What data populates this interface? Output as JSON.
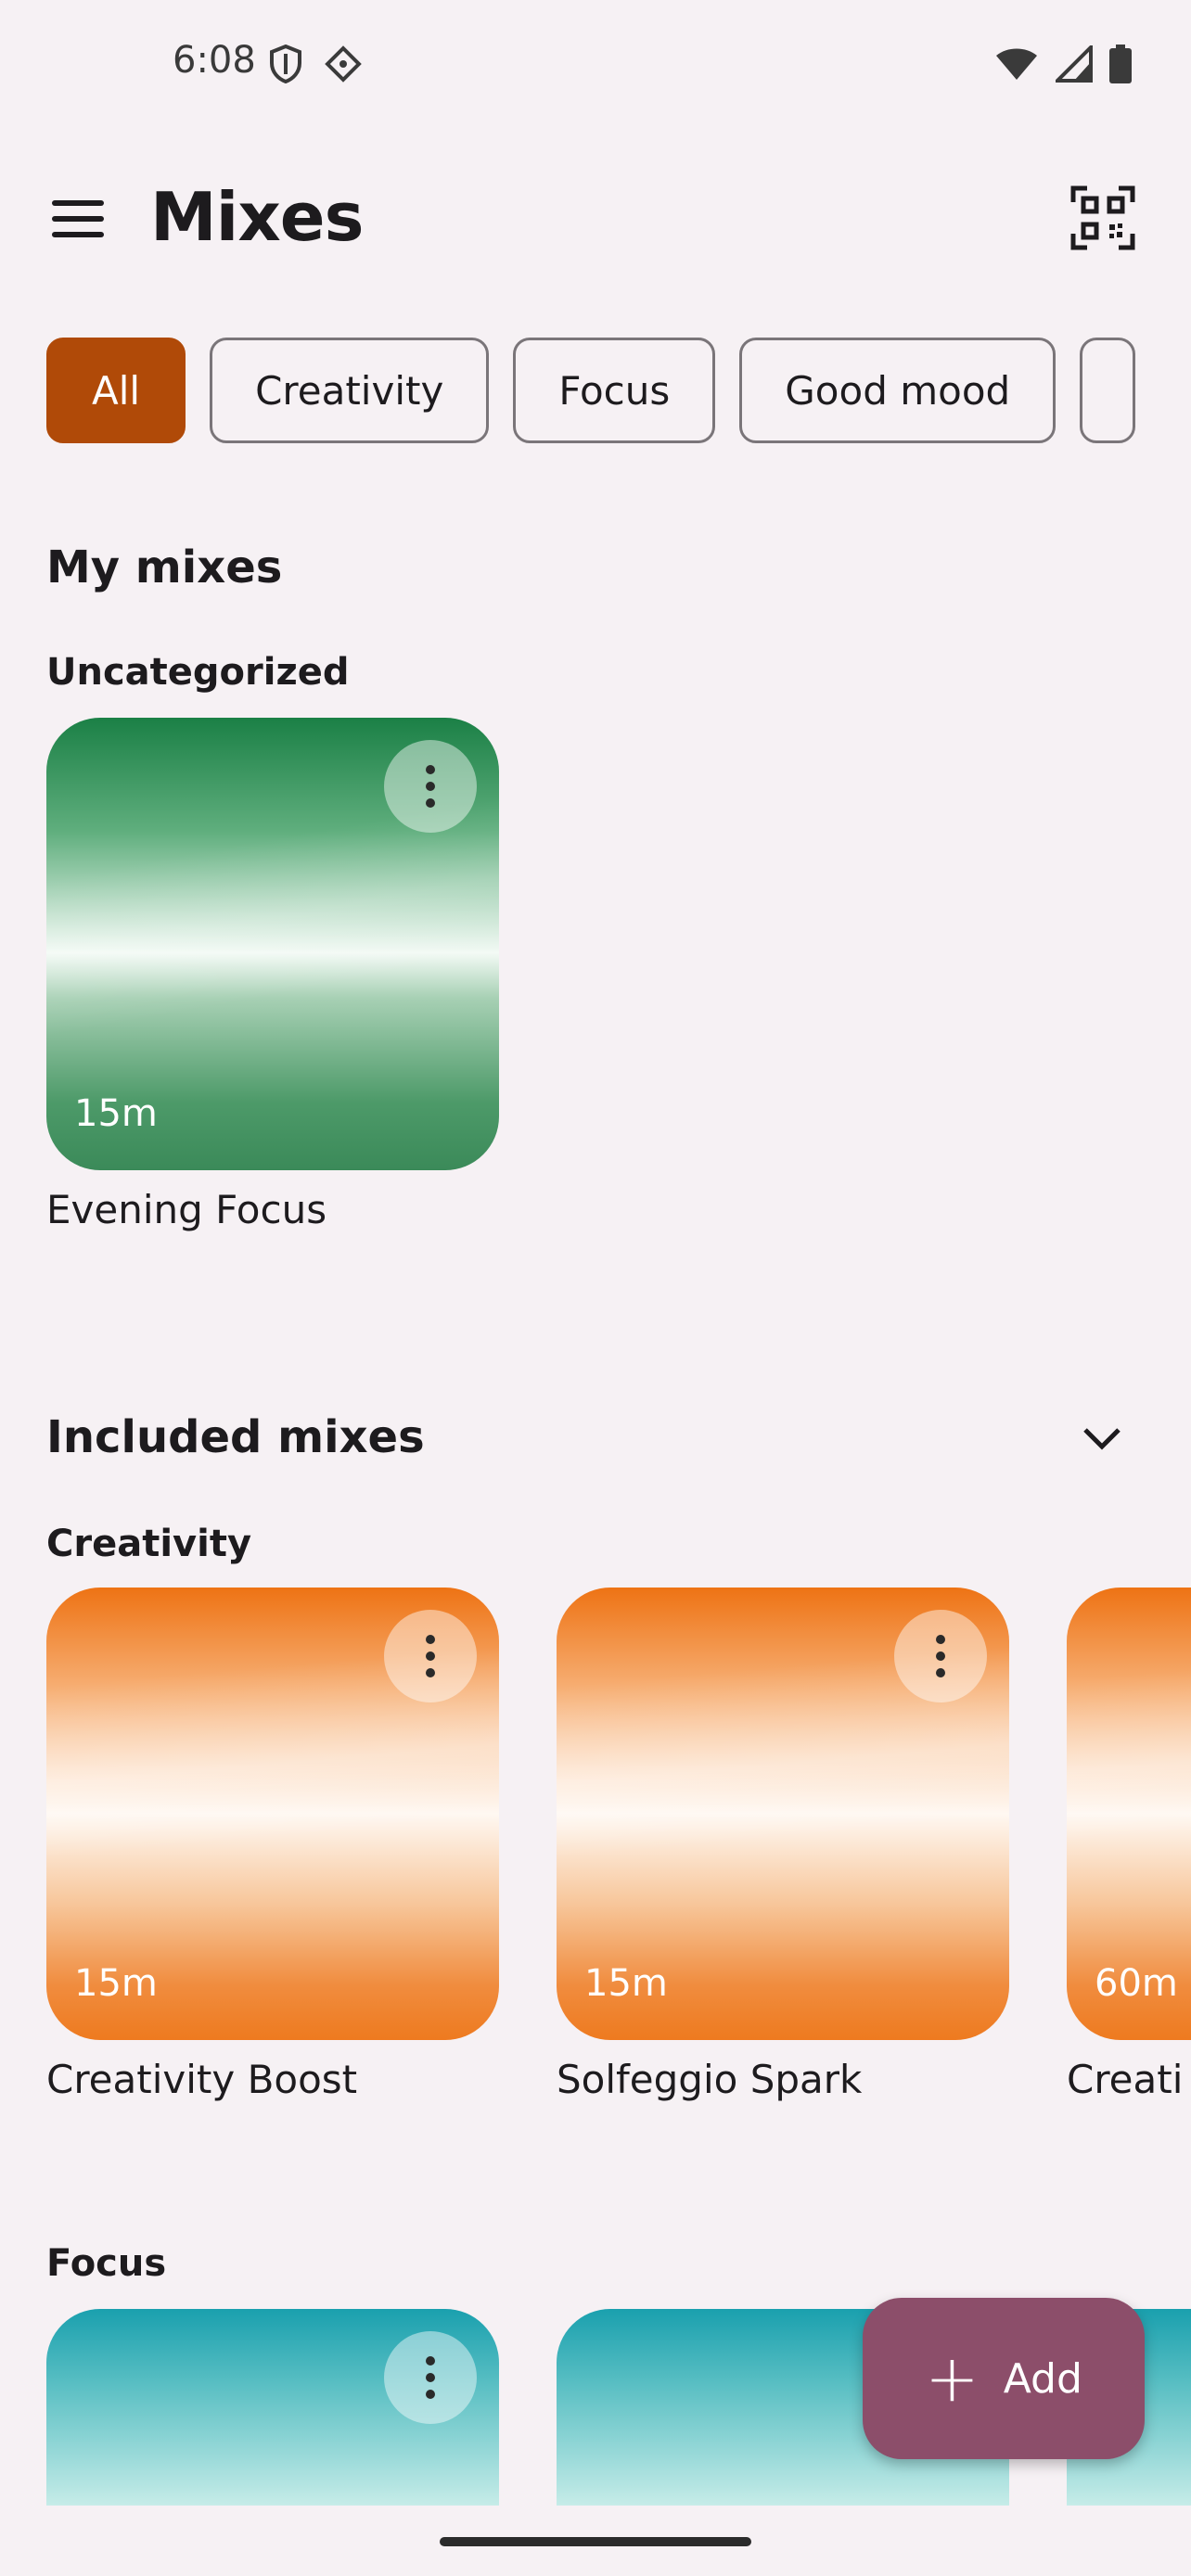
{
  "status_bar": {
    "time": "6:08",
    "icons": [
      "shield-icon",
      "vpn-key-icon",
      "wifi-icon",
      "cellular-signal-icon",
      "battery-icon"
    ]
  },
  "app_bar": {
    "title": "Mixes",
    "menu_icon": "hamburger-menu-icon",
    "qr_icon": "qr-code-scanner-icon"
  },
  "filters": {
    "chips": [
      "All",
      "Creativity",
      "Focus",
      "Good mood"
    ],
    "selected": "All",
    "accent_color": "#b04a08"
  },
  "my_mixes": {
    "title": "My mixes",
    "categories": [
      {
        "name": "Uncategorized",
        "items": [
          {
            "name": "Evening Focus",
            "duration": "15m",
            "theme": "green"
          }
        ]
      }
    ]
  },
  "included_mixes": {
    "title": "Included mixes",
    "categories": [
      {
        "name": "Creativity",
        "items": [
          {
            "name": "Creativity Boost",
            "duration": "15m",
            "theme": "orange"
          },
          {
            "name": "Solfeggio Spark",
            "duration": "15m",
            "theme": "orange"
          },
          {
            "name": "Creati",
            "duration": "60m",
            "theme": "orange"
          }
        ]
      },
      {
        "name": "Focus",
        "items": [
          {
            "name": "",
            "duration": "",
            "theme": "teal"
          },
          {
            "name": "",
            "duration": "",
            "theme": "teal"
          }
        ]
      }
    ]
  },
  "fab": {
    "label": "Add",
    "color": "#8c4e6a"
  }
}
